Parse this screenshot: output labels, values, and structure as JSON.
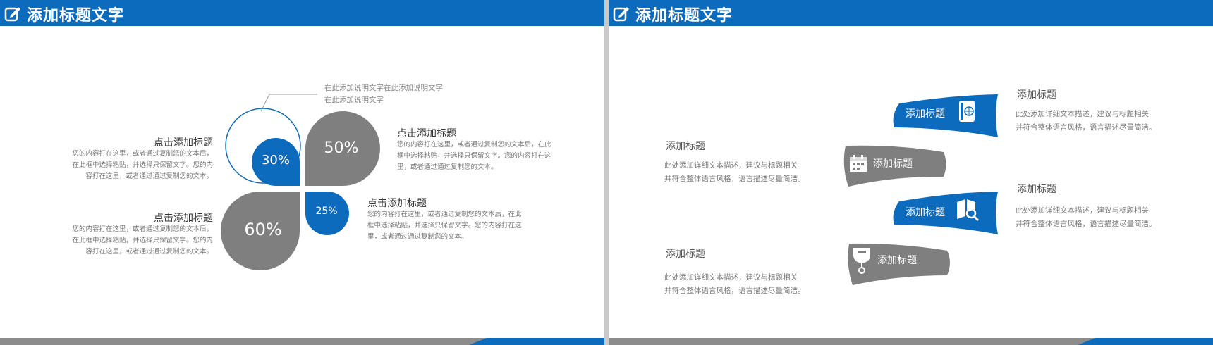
{
  "left_slide": {
    "header_title": "添加标题文字",
    "callout_line1": "在此添加说明文字在此添加说明文字",
    "callout_line2": "在此添加说明文字",
    "petals": [
      {
        "percent": "30%",
        "value": 30
      },
      {
        "percent": "50%",
        "value": 50
      },
      {
        "percent": "60%",
        "value": 60
      },
      {
        "percent": "25%",
        "value": 25
      }
    ],
    "blocks": [
      {
        "title": "点击添加标题",
        "text": "您的内容打在这里，或者通过复制您的文本后，在此框中选择粘贴，并选择只保留文字。您的内容打在这里，或者通过通过复制您的文本。"
      },
      {
        "title": "点击添加标题",
        "text": "您的内容打在这里，或者通过复制您的文本后，在此框中选择粘贴，并选择只保留文字。您的内容打在这里，或者通过通过复制您的文本。"
      },
      {
        "title": "点击添加标题",
        "text": "您的内容打在这里，或者通过复制您的文本后，在此框中选择粘贴，并选择只保留文字。您的内容打在这里，或者通过通过复制您的文本。"
      },
      {
        "title": "点击添加标题",
        "text": "您的内容打在这里，或者通过复制您的文本后，在此框中选择粘贴，并选择只保留文字。您的内容打在这里，或者通过通过复制您的文本。"
      }
    ]
  },
  "right_slide": {
    "header_title": "添加标题文字",
    "banners": [
      {
        "label": "添加标题",
        "icon": "passport-icon"
      },
      {
        "label": "添加标题",
        "icon": "calendar-icon"
      },
      {
        "label": "添加标题",
        "icon": "book-search-icon"
      },
      {
        "label": "添加标题",
        "icon": "tag-icon"
      }
    ],
    "blocks": [
      {
        "title": "添加标题",
        "line1": "此处添加详细文本描述，建议与标题相关",
        "line2": "并符合整体语言风格，语言描述尽量简洁。"
      },
      {
        "title": "添加标题",
        "line1": "此处添加详细文本描述，建议与标题相关",
        "line2": "并符合整体语言风格，语言描述尽量简洁。"
      },
      {
        "title": "添加标题",
        "line1": "此处添加详细文本描述，建议与标题相关",
        "line2": "并符合整体语言风格，语言描述尽量简洁。"
      },
      {
        "title": "添加标题",
        "line1": "此处添加详细文本描述，建议与标题相关",
        "line2": "并符合整体语言风格，语言描述尽量简洁。"
      }
    ]
  },
  "colors": {
    "blue": "#0d6bbd",
    "gray": "#7f7f7f"
  }
}
